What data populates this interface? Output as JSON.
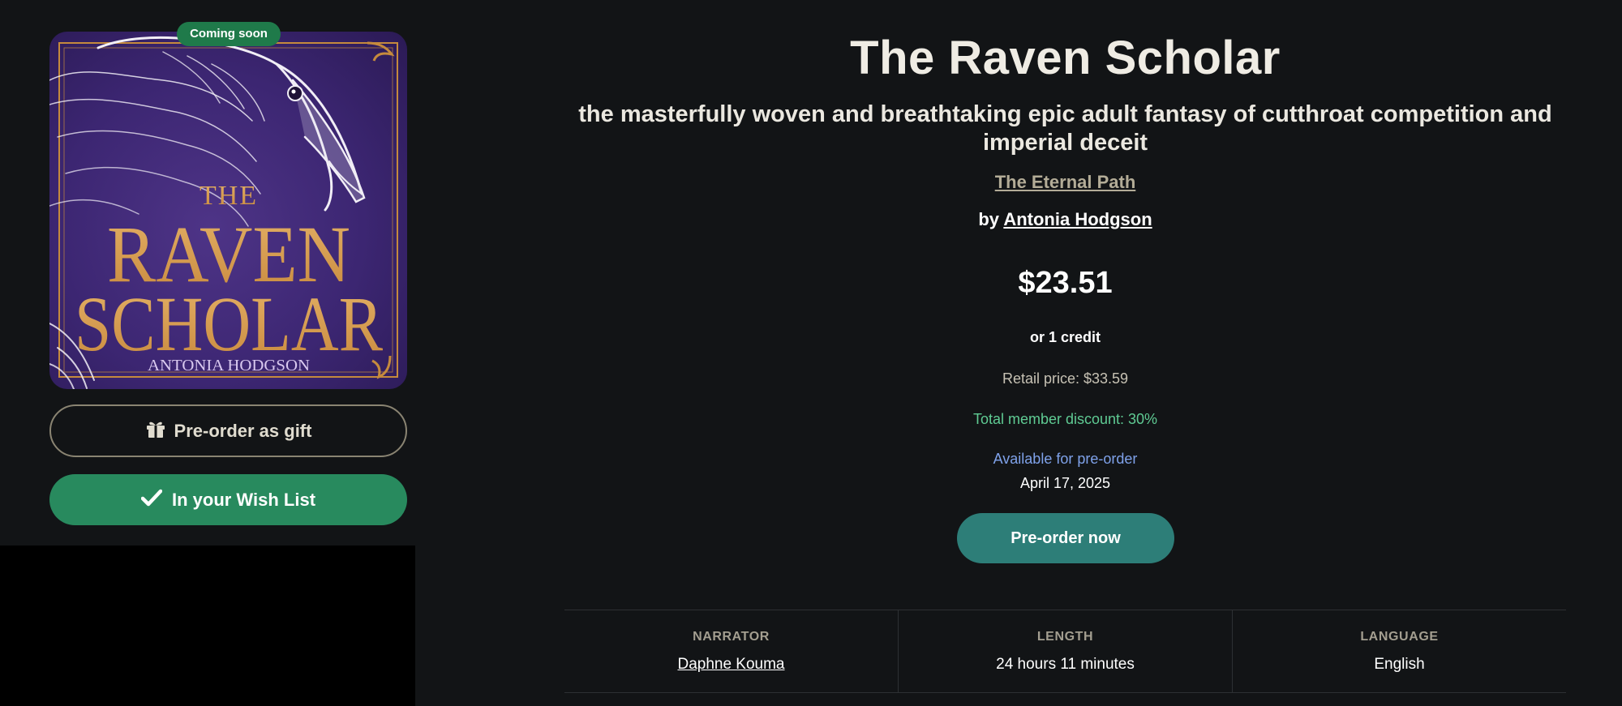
{
  "cover": {
    "badge": "Coming soon",
    "text_the": "THE",
    "text_raven": "RAVEN",
    "text_scholar": "SCHOLAR",
    "text_author": "ANTONIA HODGSON"
  },
  "actions": {
    "gift_label": "Pre-order as gift",
    "wishlist_label": "In your Wish List",
    "preorder_label": "Pre-order now"
  },
  "book": {
    "title": "The Raven Scholar",
    "subtitle": "the masterfully woven and breathtaking epic adult fantasy of cutthroat competition and imperial deceit",
    "series": "The Eternal Path",
    "by": "by",
    "author": "Antonia Hodgson"
  },
  "pricing": {
    "price": "$23.51",
    "credit": "or 1 credit",
    "retail": "Retail price: $33.59",
    "discount": "Total member discount: 30%",
    "availability": "Available for pre-order",
    "release_date": "April 17, 2025"
  },
  "details": [
    {
      "label": "NARRATOR",
      "value": "Daphne Kouma"
    },
    {
      "label": "LENGTH",
      "value": "24 hours 11 minutes"
    },
    {
      "label": "LANGUAGE",
      "value": "English"
    }
  ],
  "colors": {
    "background": "#121416",
    "cover_purple": "#3c2672",
    "cover_gold": "#d99a4e",
    "badge_green": "#1f7a4a",
    "wishlist_green": "#288a5e",
    "preorder_teal": "#2d7e78",
    "discount_green": "#5fcb93",
    "availability_blue": "#7fa2ea"
  },
  "icons": [
    "gift-icon",
    "checkmark-icon",
    "raven-illustration"
  ]
}
